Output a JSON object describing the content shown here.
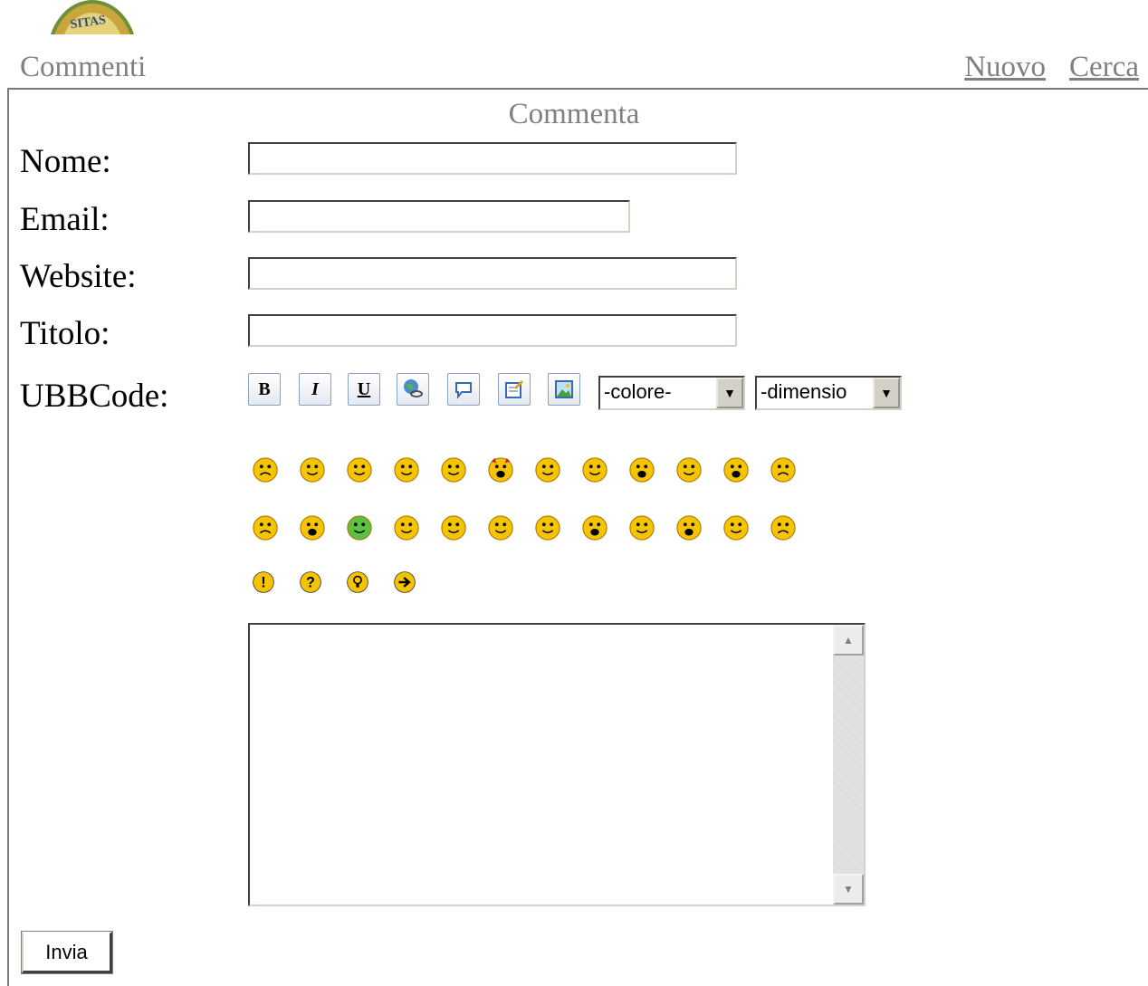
{
  "header": {
    "section_title": "Commenti",
    "nav": {
      "new_label": "Nuovo",
      "search_label": "Cerca"
    }
  },
  "form": {
    "title": "Commenta",
    "name_label": "Nome:",
    "email_label": "Email:",
    "website_label": "Website:",
    "title_label": "Titolo:",
    "ubbcode_label": "UBBCode:",
    "name_value": "",
    "email_value": "",
    "website_value": "",
    "title_value": "",
    "message_value": "",
    "submit_label": "Invia"
  },
  "toolbar": {
    "bold_icon_text": "B",
    "italic_icon_text": "I",
    "underline_icon_text": "U",
    "buttons": [
      "bold-icon",
      "italic-icon",
      "underline-icon",
      "link-icon",
      "quote-icon",
      "email-icon",
      "image-icon"
    ],
    "color_select_value": "-colore-",
    "size_select_value": "-dimensio"
  },
  "smileys": {
    "row1": [
      "angry-icon",
      "confused-icon",
      "sleepy-icon",
      "happy-icon",
      "cool-icon",
      "devil-icon",
      "angel-icon",
      "rolleyes-icon",
      "grin-icon",
      "kiss-icon",
      "laugh-icon",
      "annoyed-icon"
    ],
    "row2": [
      "sad-icon",
      "shocked-icon",
      "sick-icon",
      "sealed-icon",
      "smile-icon",
      "tongue-icon",
      "blush-icon",
      "crazy-icon",
      "thinking-icon",
      "surprised-icon",
      "wink-icon",
      "worried-icon"
    ],
    "row3": [
      "exclamation-icon",
      "question-icon",
      "idea-icon",
      "arrow-icon"
    ]
  },
  "colors": {
    "muted_text": "#808080",
    "smiley": "#f5c400",
    "frame": "#737c86"
  }
}
